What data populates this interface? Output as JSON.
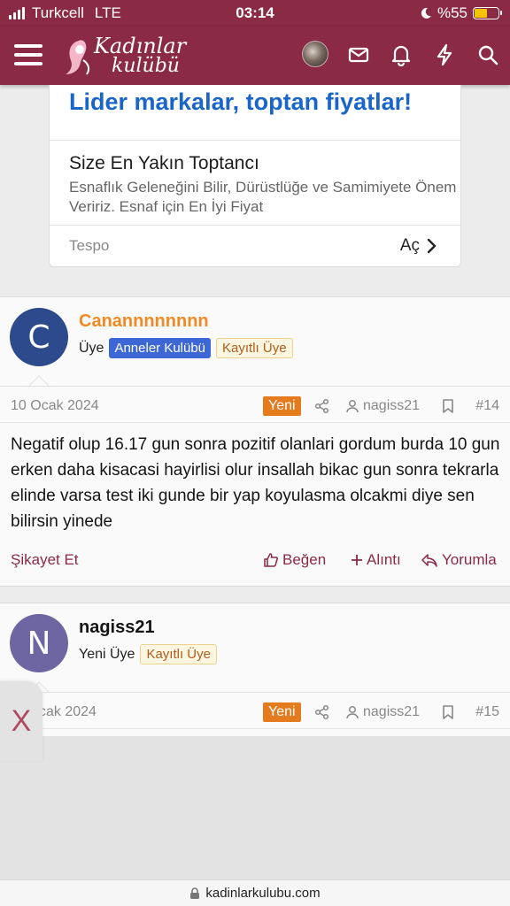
{
  "status_bar": {
    "carrier": "Turkcell",
    "network": "LTE",
    "time": "03:14",
    "battery": "%55"
  },
  "nav": {
    "logo_line1": "Kadınlar",
    "logo_line2": "kulübü"
  },
  "ad": {
    "headline": "Lider markalar, toptan fiyatlar!",
    "title": "Size En Yakın Toptancı",
    "description": "Esnaflık Geleneğini Bilir, Dürüstlüğe ve Samimiyete Önem Veririz. Esnaf için En İyi Fiyat",
    "source": "Tespo",
    "open_label": "Aç"
  },
  "posts": [
    {
      "avatar_letter": "C",
      "avatar_color": "#2c4a8c",
      "username": "Canannnnnnnn",
      "username_color": "#f08a24",
      "role": "Üye",
      "badges": [
        "Anneler Kulübü",
        "Kayıtlı Üye"
      ],
      "date": "10 Ocak 2024",
      "new_label": "Yeni",
      "author": "nagiss21",
      "number": "#14",
      "message": "Negatif olup 16.17 gun sonra pozitif olanlari gordum burda 10 gun erken daha kisacasi hayirlisi olur insallah bikac gun sonra tekrarla elinde varsa test iki gunde bir yap koyulasma olcakmi diye sen bilirsin yinede",
      "actions": {
        "report": "Şikayet Et",
        "like": "Beğen",
        "quote": "Alıntı",
        "reply": "Yorumla"
      }
    },
    {
      "avatar_letter": "N",
      "avatar_color": "#6e65a3",
      "username": "nagiss21",
      "username_color": "#141414",
      "role": "Yeni Üye",
      "badges": [
        "Kayıtlı Üye"
      ],
      "date": "cak 2024",
      "new_label": "Yeni",
      "author": "nagiss21",
      "number": "#15"
    }
  ],
  "overlay": {
    "close_label": "X"
  },
  "browser": {
    "url": "kadinlarkulubu.com"
  }
}
